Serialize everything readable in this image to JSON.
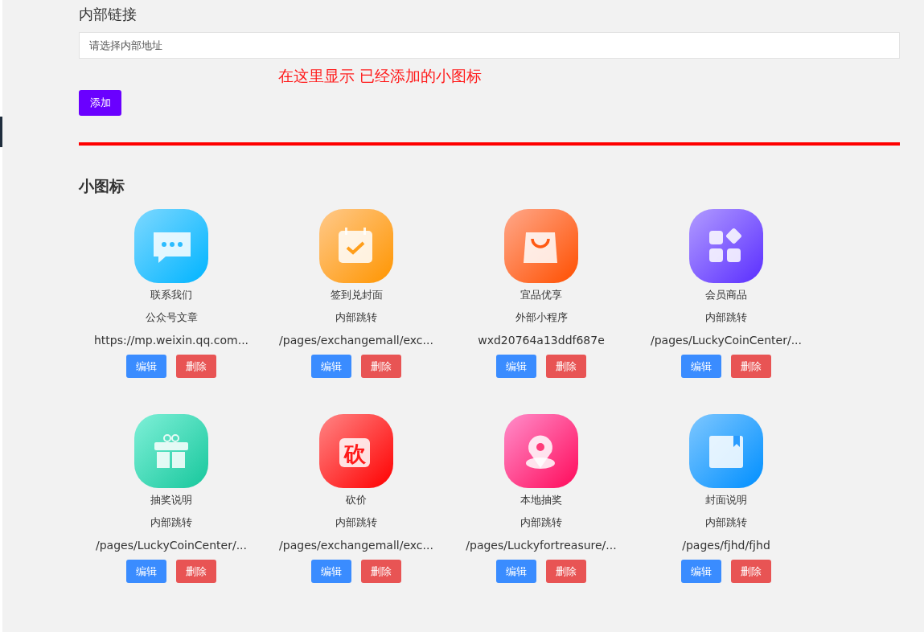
{
  "internal_link": {
    "label": "内部链接",
    "placeholder": "请选择内部地址"
  },
  "note": "在这里显示 已经添加的小图标",
  "add_button": "添加",
  "section_title": "小图标",
  "icons": [
    {
      "name": "联系我们",
      "type": "公众号文章",
      "link": "https://mp.weixin.qq.com...",
      "edit": "编辑",
      "delete": "删除"
    },
    {
      "name": "签到兑封面",
      "type": "内部跳转",
      "link": "/pages/exchangemall/exc...",
      "edit": "编辑",
      "delete": "删除"
    },
    {
      "name": "宜品优享",
      "type": "外部小程序",
      "link": "wxd20764a13ddf687e",
      "edit": "编辑",
      "delete": "删除"
    },
    {
      "name": "会员商品",
      "type": "内部跳转",
      "link": "/pages/LuckyCoinCenter/...",
      "edit": "编辑",
      "delete": "删除"
    },
    {
      "name": "抽奖说明",
      "type": "内部跳转",
      "link": "/pages/LuckyCoinCenter/...",
      "edit": "编辑",
      "delete": "删除"
    },
    {
      "name": "砍价",
      "type": "内部跳转",
      "link": "/pages/exchangemall/exc...",
      "edit": "编辑",
      "delete": "删除",
      "icon_text": "砍"
    },
    {
      "name": "本地抽奖",
      "type": "内部跳转",
      "link": "/pages/Luckyfortreasure/...",
      "edit": "编辑",
      "delete": "删除"
    },
    {
      "name": "封面说明",
      "type": "内部跳转",
      "link": "/pages/fjhd/fjhd",
      "edit": "编辑",
      "delete": "删除"
    }
  ]
}
